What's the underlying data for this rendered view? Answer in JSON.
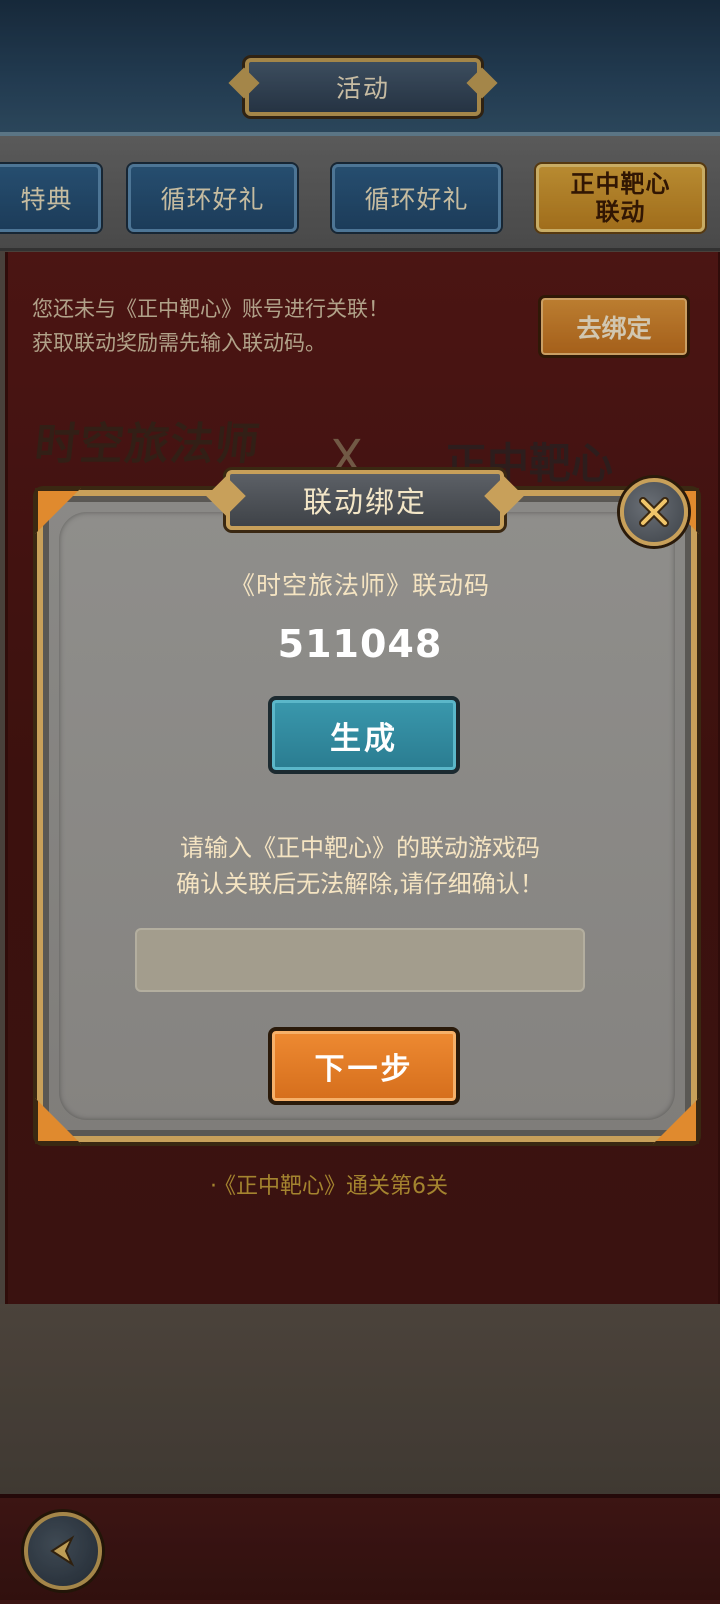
{
  "header": {
    "title": "活动"
  },
  "tabs": [
    {
      "label": "特典"
    },
    {
      "label": "循环好礼"
    },
    {
      "label": "循环好礼"
    },
    {
      "label_line1": "正中靶心",
      "label_line2": "联动"
    }
  ],
  "panel": {
    "notice_line1": "您还未与《正中靶心》账号进行关联！",
    "notice_line2": "获取联动奖励需先输入联动码。",
    "bind_button": "去绑定",
    "banner_left": "时空旅法师",
    "banner_x": "X",
    "banner_right": "正中靶心",
    "task_hint": "《正中靶心》通关第6关"
  },
  "modal": {
    "title": "联动绑定",
    "code_label": "《时空旅法师》联动码",
    "code_value": "511048",
    "generate_button": "生成",
    "instruction_line1": "请输入《正中靶心》的联动游戏码",
    "instruction_line2": "确认关联后无法解除,请仔细确认！",
    "input_value": "",
    "input_placeholder": "",
    "next_button": "下一步"
  },
  "colors": {
    "accent_gold": "#c8a05a",
    "tab_active": "#e0a93c",
    "button_teal": "#3a98ad",
    "button_orange": "#ee8a32",
    "panel_red": "#5c1a18"
  },
  "icons": {
    "close": "close-x-icon",
    "back": "back-arrow-icon"
  }
}
